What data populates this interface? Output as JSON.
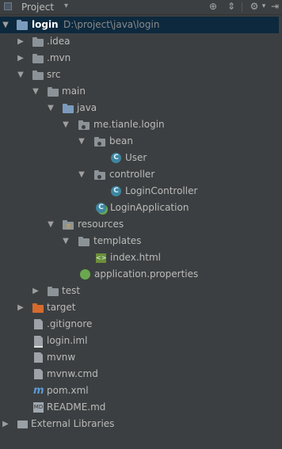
{
  "header": {
    "title": "Project",
    "tools": [
      "target-icon",
      "collapse-icon",
      "gear-icon",
      "hide-icon"
    ]
  },
  "colors": {
    "selection": "#0d293e",
    "folder_blue": "#7b9bbd",
    "folder_orange": "#d66b2e",
    "class_icon": "#3e86a0"
  },
  "tree": [
    {
      "label": "login",
      "path": "D:\\project\\java\\login",
      "icon": "module-folder",
      "expanded": true,
      "selected": true
    },
    {
      "label": ".idea",
      "icon": "folder",
      "expanded": false
    },
    {
      "label": ".mvn",
      "icon": "folder",
      "expanded": false
    },
    {
      "label": "src",
      "icon": "folder",
      "expanded": true
    },
    {
      "label": "main",
      "icon": "folder",
      "expanded": true
    },
    {
      "label": "java",
      "icon": "source-folder",
      "expanded": true
    },
    {
      "label": "me.tianle.login",
      "icon": "package",
      "expanded": true
    },
    {
      "label": "bean",
      "icon": "package",
      "expanded": true
    },
    {
      "label": "User",
      "icon": "class"
    },
    {
      "label": "controller",
      "icon": "package",
      "expanded": true
    },
    {
      "label": "LoginController",
      "icon": "class"
    },
    {
      "label": "LoginApplication",
      "icon": "spring-class"
    },
    {
      "label": "resources",
      "icon": "resources-folder",
      "expanded": true
    },
    {
      "label": "templates",
      "icon": "folder",
      "expanded": true
    },
    {
      "label": "index.html",
      "icon": "html-file"
    },
    {
      "label": "application.properties",
      "icon": "properties-file"
    },
    {
      "label": "test",
      "icon": "folder",
      "expanded": false
    },
    {
      "label": "target",
      "icon": "excluded-folder",
      "expanded": false
    },
    {
      "label": ".gitignore",
      "icon": "text-file"
    },
    {
      "label": "login.iml",
      "icon": "iml-file"
    },
    {
      "label": "mvnw",
      "icon": "text-file"
    },
    {
      "label": "mvnw.cmd",
      "icon": "text-file"
    },
    {
      "label": "pom.xml",
      "icon": "maven-file"
    },
    {
      "label": "README.md",
      "icon": "markdown-file"
    },
    {
      "label": "External Libraries",
      "icon": "library",
      "expanded": false
    }
  ]
}
